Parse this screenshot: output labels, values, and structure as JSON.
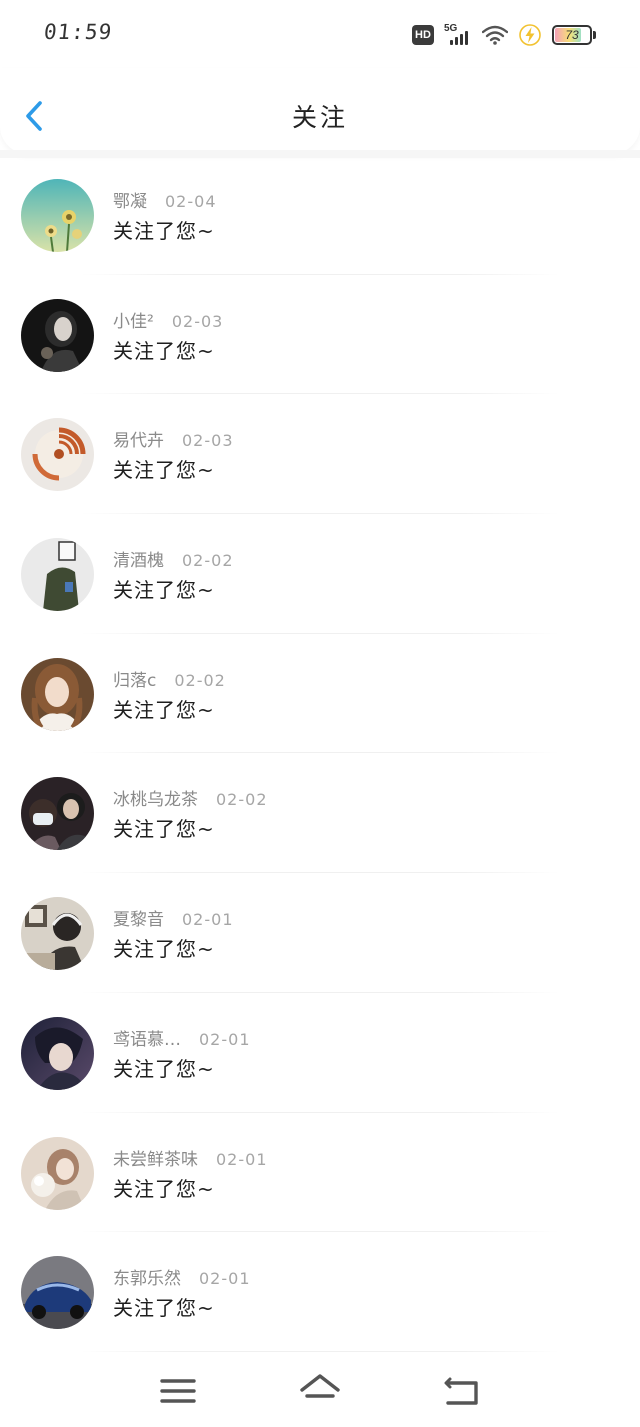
{
  "status_bar": {
    "time": "01:59",
    "hd_label": "HD",
    "network_label": "5G",
    "battery_level": "73",
    "icons": [
      "hd-icon",
      "signal-icon",
      "wifi-icon",
      "charging-icon",
      "battery-icon"
    ]
  },
  "header": {
    "title": "关注",
    "back_icon": "chevron-left-icon",
    "accent_color": "#2d9be8"
  },
  "follow_list": [
    {
      "name": "鄂凝",
      "date": "02-04",
      "message": "关注了您~"
    },
    {
      "name": "小佳²",
      "date": "02-03",
      "message": "关注了您~"
    },
    {
      "name": "易代卉",
      "date": "02-03",
      "message": "关注了您~"
    },
    {
      "name": "清酒槐",
      "date": "02-02",
      "message": "关注了您~"
    },
    {
      "name": "归落c",
      "date": "02-02",
      "message": "关注了您~"
    },
    {
      "name": "冰桃乌龙茶",
      "date": "02-02",
      "message": "关注了您~"
    },
    {
      "name": "夏黎音",
      "date": "02-01",
      "message": "关注了您~"
    },
    {
      "name": "鸢语慕…",
      "date": "02-01",
      "message": "关注了您~"
    },
    {
      "name": "未尝鲜茶味",
      "date": "02-01",
      "message": "关注了您~"
    },
    {
      "name": "东郭乐然",
      "date": "02-01",
      "message": "关注了您~"
    }
  ],
  "nav_bar": {
    "icons": [
      "menu-icon",
      "home-icon",
      "back-icon"
    ]
  }
}
